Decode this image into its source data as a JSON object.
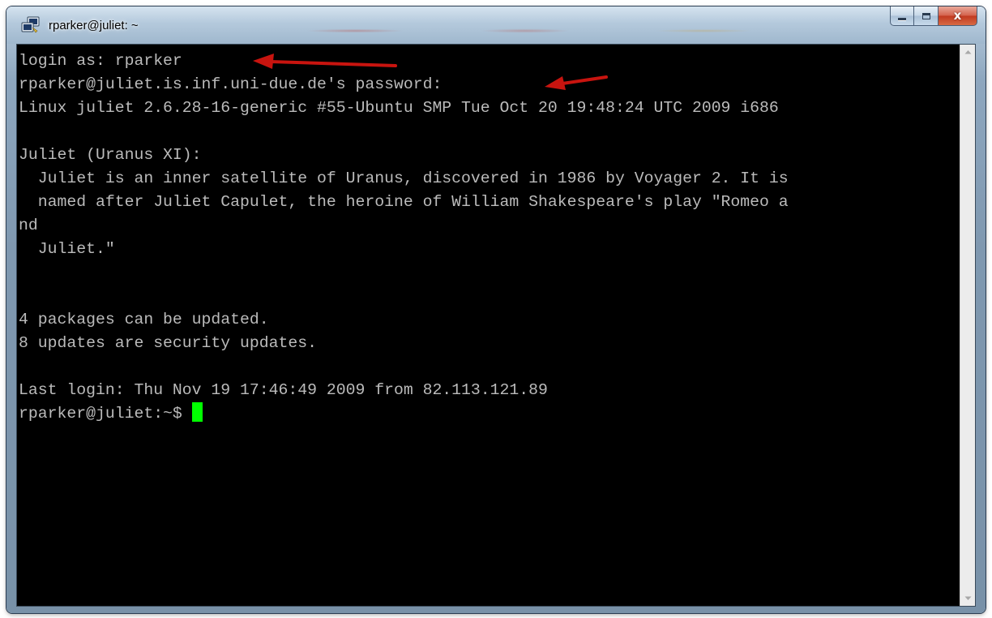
{
  "window": {
    "title": "rparker@juliet: ~",
    "close_glyph": "x"
  },
  "terminal": {
    "lines": [
      "login as: rparker",
      "rparker@juliet.is.inf.uni-due.de's password:",
      "Linux juliet 2.6.28-16-generic #55-Ubuntu SMP Tue Oct 20 19:48:24 UTC 2009 i686",
      "",
      "Juliet (Uranus XI):",
      "  Juliet is an inner satellite of Uranus, discovered in 1986 by Voyager 2. It is",
      "  named after Juliet Capulet, the heroine of William Shakespeare's play \"Romeo a",
      "nd",
      "  Juliet.\"",
      "",
      "",
      "4 packages can be updated.",
      "8 updates are security updates.",
      "",
      "Last login: Thu Nov 19 17:46:49 2009 from 82.113.121.89"
    ],
    "prompt": "rparker@juliet:~$"
  },
  "colors": {
    "terminal_bg": "#000000",
    "terminal_fg": "#bbbbbb",
    "cursor": "#00ff00",
    "annotation_arrow": "#c8140f"
  },
  "icons": {
    "app": "putty-icon",
    "minimize": "minimize-icon",
    "maximize": "maximize-icon",
    "close": "close-icon",
    "scroll_up": "scroll-up-arrow-icon",
    "scroll_down": "scroll-down-arrow-icon",
    "annotation": "red-arrow-annotation"
  }
}
